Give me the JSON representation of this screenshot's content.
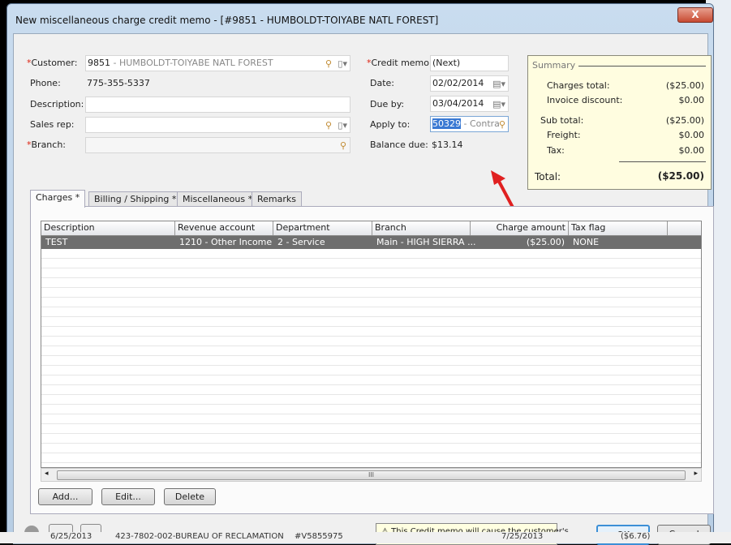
{
  "window": {
    "title": "New miscellaneous charge credit memo - [#9851 - HUMBOLDT-TOIYABE NATL FOREST]",
    "close_label": "X"
  },
  "form": {
    "customer": {
      "label": "Customer:",
      "code": "9851",
      "name": " - HUMBOLDT-TOIYABE NATL FOREST"
    },
    "phone": {
      "label": "Phone:",
      "value": "775-355-5337"
    },
    "description": {
      "label": "Description:",
      "value": ""
    },
    "sales_rep": {
      "label": "Sales rep:",
      "value": ""
    },
    "branch": {
      "label": "Branch:",
      "value": ""
    },
    "credit_memo": {
      "label": "Credit memo:",
      "value": "(Next)"
    },
    "date": {
      "label": "Date:",
      "value": "02/02/2014"
    },
    "due_by": {
      "label": "Due by:",
      "value": "03/04/2014"
    },
    "apply_to": {
      "label": "Apply to:",
      "selected": "50329",
      "rest": " - Contrac"
    },
    "balance_due": {
      "label": "Balance due:",
      "value": "$13.14"
    }
  },
  "summary": {
    "title": "Summary",
    "rows": [
      {
        "label": "Charges total:",
        "value": "($25.00)"
      },
      {
        "label": "Invoice discount:",
        "value": "$0.00"
      },
      {
        "label": "Sub total:",
        "value": "($25.00)"
      },
      {
        "label": "Freight:",
        "value": "$0.00"
      },
      {
        "label": "Tax:",
        "value": "$0.00"
      }
    ],
    "total_label": "Total:",
    "total_value": "($25.00)"
  },
  "tabs": [
    {
      "label": "Charges *"
    },
    {
      "label": "Billing / Shipping *"
    },
    {
      "label": "Miscellaneous *"
    },
    {
      "label": "Remarks"
    }
  ],
  "grid": {
    "columns": [
      "Description",
      "Revenue account",
      "Department",
      "Branch",
      "Charge amount",
      "Tax flag"
    ],
    "rows": [
      [
        "TEST",
        "1210 - Other Income",
        "2 - Service",
        "Main - HIGH SIERRA ...",
        "($25.00)",
        "NONE"
      ]
    ],
    "scroll_grip": "III"
  },
  "buttons": {
    "add": "Add...",
    "edit": "Edit...",
    "delete": "Delete",
    "ok": "OK",
    "cancel": "Cancel"
  },
  "warning": "This Credit memo will cause the customer's",
  "background_row": {
    "date": "6/25/2013",
    "text": "423-7802-002-BUREAU OF RECLAMATION",
    "ref": "#V5855975",
    "date2": "7/25/2013",
    "amount": "($6.76)"
  },
  "colors": {
    "accent_arrow": "#e02020",
    "summary_bg": "#fffde0",
    "selected_row": "#6e6e6e"
  }
}
